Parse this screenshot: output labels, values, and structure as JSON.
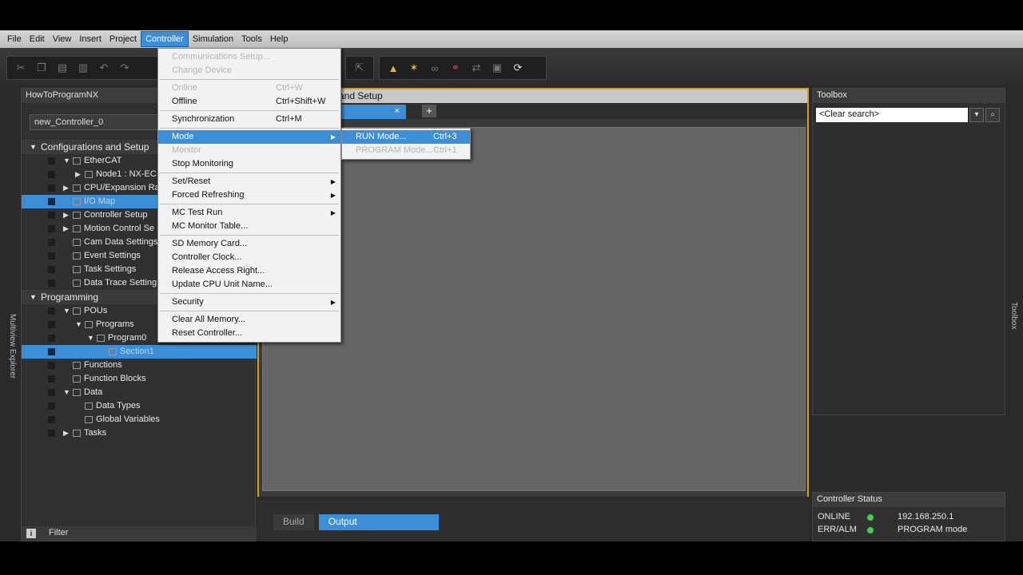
{
  "menubar": [
    "File",
    "Edit",
    "View",
    "Insert",
    "Project",
    "Controller",
    "Simulation",
    "Tools",
    "Help"
  ],
  "active_menu": "Controller",
  "left_panel": {
    "title": "HowToProgramNX",
    "controller_combo": "new_Controller_0",
    "group1": "Configurations and Setup",
    "group2": "Programming",
    "config_items": [
      "EtherCAT",
      "Node1 : NX-EC",
      "CPU/Expansion Ra",
      "I/O Map",
      "Controller Setup",
      "Motion Control Se",
      "Cam Data Settings",
      "Event Settings",
      "Task Settings",
      "Data Trace Setting"
    ],
    "prog_items": [
      "POUs",
      "Programs",
      "Program0",
      "Section1",
      "Functions",
      "Function Blocks",
      "Data",
      "Data Types",
      "Global Variables",
      "Tasks"
    ],
    "filter": "Filter",
    "vertical_tab": "Multiview Explorer"
  },
  "editor": {
    "title": "and Setup"
  },
  "output": {
    "tabs": [
      "Build",
      "Output"
    ]
  },
  "toolbox": {
    "title": "Toolbox",
    "search_placeholder": "<Clear search>",
    "vertical_tab": "Toolbox"
  },
  "controller_status": {
    "title": "Controller Status",
    "online_label": "ONLINE",
    "online_value": "192.168.250.1",
    "err_label": "ERR/ALM",
    "err_value": "PROGRAM mode",
    "led_color": "#3fcf4a"
  },
  "controller_menu": [
    {
      "label": "Communications Setup...",
      "disabled": true
    },
    {
      "label": "Change Device",
      "disabled": true
    },
    {
      "sep": true
    },
    {
      "label": "Online",
      "shortcut": "Ctrl+W",
      "disabled": true
    },
    {
      "label": "Offline",
      "shortcut": "Ctrl+Shift+W"
    },
    {
      "sep": true
    },
    {
      "label": "Synchronization",
      "shortcut": "Ctrl+M"
    },
    {
      "sep": true
    },
    {
      "label": "Mode",
      "submenu": true,
      "highlight": true
    },
    {
      "label": "Monitor",
      "disabled": true
    },
    {
      "label": "Stop Monitoring"
    },
    {
      "sep": true
    },
    {
      "label": "Set/Reset",
      "submenu": true
    },
    {
      "label": "Forced Refreshing",
      "submenu": true
    },
    {
      "sep": true
    },
    {
      "label": "MC Test Run",
      "submenu": true
    },
    {
      "label": "MC Monitor Table..."
    },
    {
      "sep": true
    },
    {
      "label": "SD Memory Card..."
    },
    {
      "label": "Controller Clock..."
    },
    {
      "label": "Release Access Right..."
    },
    {
      "label": "Update CPU Unit Name..."
    },
    {
      "sep": true
    },
    {
      "label": "Security",
      "submenu": true
    },
    {
      "sep": true
    },
    {
      "label": "Clear All Memory..."
    },
    {
      "label": "Reset Controller..."
    }
  ],
  "mode_submenu": [
    {
      "label": "RUN Mode...",
      "shortcut": "Ctrl+3",
      "highlight": true
    },
    {
      "label": "PROGRAM Mode...",
      "shortcut": "Ctrl+1",
      "disabled": true
    }
  ]
}
